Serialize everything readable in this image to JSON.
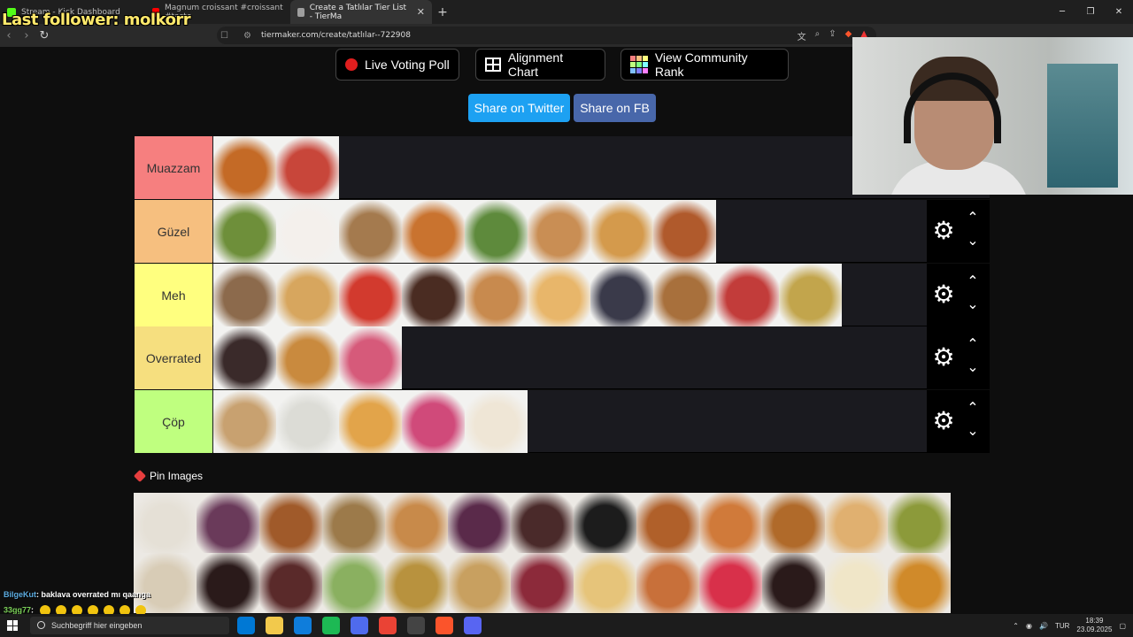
{
  "browser": {
    "tabs": [
      {
        "title": "Stream - Kick Dashboard",
        "favicon_color": "#53fc18"
      },
      {
        "title": "Magnum croissant #croissant #taste",
        "favicon_color": "#ff0000"
      },
      {
        "title": "Create a Tatlılar Tier List - TierMa",
        "favicon_color": "#9e9e9e"
      }
    ],
    "new_tab": "+",
    "url": "tiermaker.com/create/tatlılar--722908"
  },
  "overlay": {
    "last_follower": "Last follower: molkorr"
  },
  "top_buttons": {
    "live_voting": "Live Voting Poll",
    "alignment_chart": "Alignment Chart",
    "community_rank": "View Community Rank"
  },
  "share": {
    "twitter": "Share on Twitter",
    "facebook": "Share on FB",
    "twitter_color": "#1da1f2",
    "facebook_color": "#4867aa"
  },
  "tiers": [
    {
      "label": "Muazzam",
      "color": "#f67f7f",
      "item_count": 2,
      "items": [
        "#c46a26",
        "#c8463a"
      ]
    },
    {
      "label": "Güzel",
      "color": "#f6bf7f",
      "item_count": 8,
      "items": [
        "#6e8f3a",
        "#f4f0ec",
        "#a47a4e",
        "#c9732f",
        "#5e8a3c",
        "#c98e54",
        "#d49a4c",
        "#b05a2c"
      ]
    },
    {
      "label": "Meh",
      "color": "#ffff7f",
      "item_count": 10,
      "items": [
        "#8c6a4c",
        "#d7a65e",
        "#d23a2e",
        "#4a2c22",
        "#c88a4e",
        "#e8b66a",
        "#3a3a4a",
        "#a8703c",
        "#c23c3a",
        "#c2a54c"
      ]
    },
    {
      "label": "Overrated",
      "color": "#f6df7f",
      "item_count": 3,
      "items": [
        "#3a2a2a",
        "#c98a3e",
        "#d65a7a"
      ]
    },
    {
      "label": "Çöp",
      "color": "#bfff7f",
      "item_count": 5,
      "items": [
        "#c8a170",
        "#dcdcd6",
        "#e2a44a",
        "#d04a7a",
        "#efe6d6"
      ]
    }
  ],
  "pin_images": {
    "label": "Pin Images",
    "row1": [
      "#e5e0d6",
      "#6a3a5a",
      "#a05a2a",
      "#9c7a4a",
      "#c88a4a",
      "#5a2a4a",
      "#4a2a2a",
      "#1c1c1c",
      "#b0602a",
      "#d07a3a",
      "#b06a2a",
      "#e0b070",
      "#8c9a3a"
    ],
    "row2": [
      "#d8ccb6",
      "#2a1a1a",
      "#5a2a2a",
      "#8ab060",
      "#b8923e",
      "#c8a060",
      "#8c2a3a",
      "#e6c47a",
      "#c8703a",
      "#d8304a",
      "#2a1a1a",
      "#f0e6c8",
      "#d08a2a"
    ]
  },
  "chat": {
    "line1_user": "BilgeKut",
    "line1_msg": ": baklava overrated mı qaanga",
    "line2_user": "33gg77",
    "line2_msg": ":"
  },
  "taskbar": {
    "search_placeholder": "Suchbegriff hier eingeben",
    "language": "TUR",
    "time": "18:39",
    "date": "23.09.2025",
    "apps": [
      "#0078d4",
      "#f2c94c",
      "#0f7ddb",
      "#1db954",
      "#4f6bed",
      "#ea4335",
      "#444444",
      "#fb542b",
      "#5865f2"
    ]
  }
}
